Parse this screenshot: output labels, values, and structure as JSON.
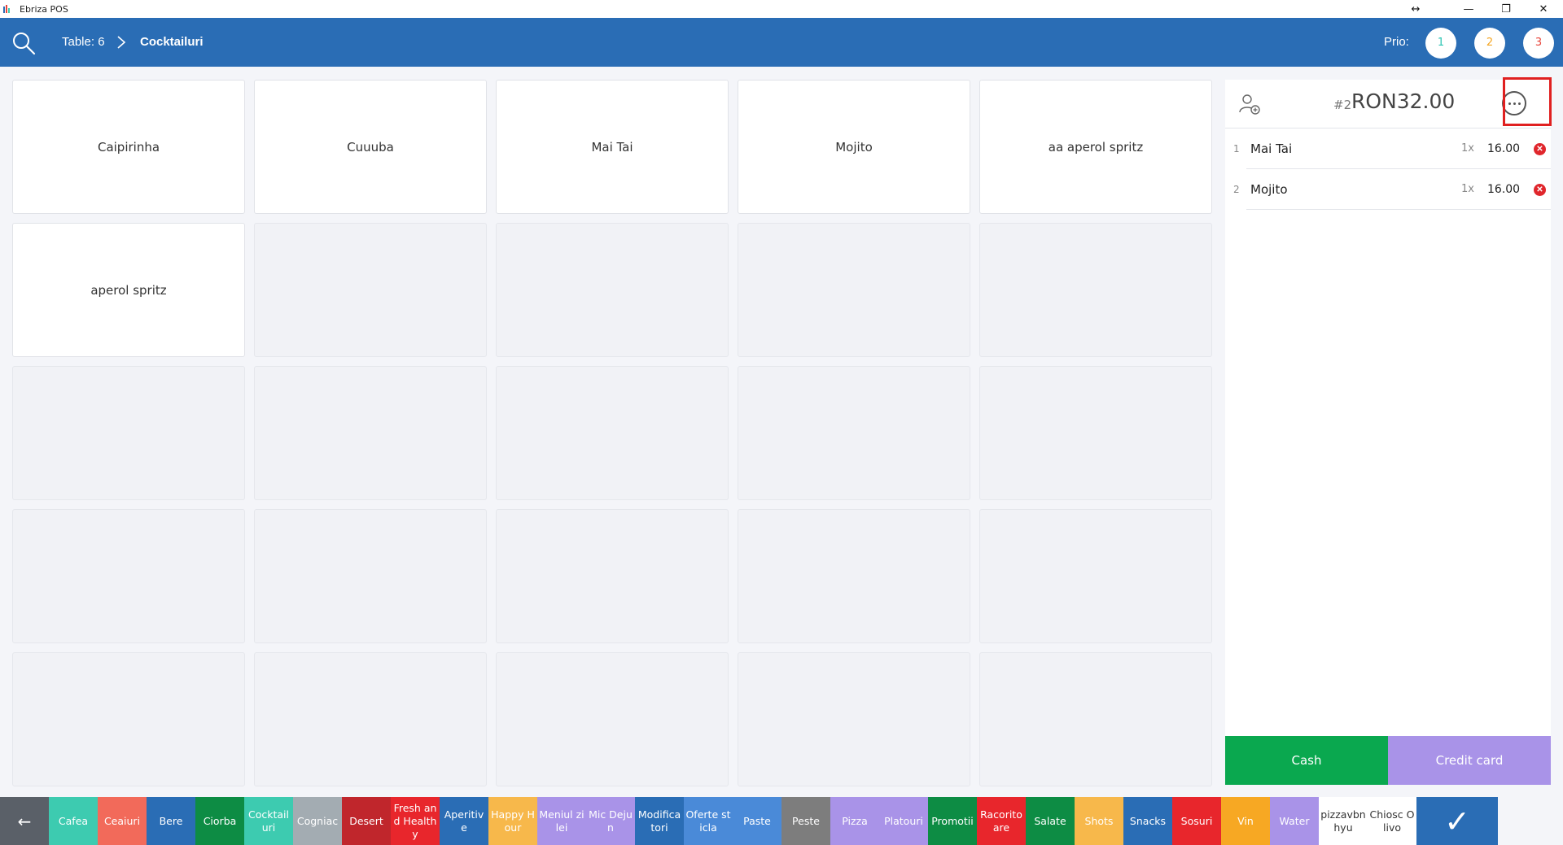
{
  "window": {
    "title": "Ebriza POS",
    "controls": {
      "resize": "↔",
      "minimize": "—",
      "restore": "❐",
      "close": "✕"
    }
  },
  "header": {
    "table": "Table: 6",
    "category": "Cocktailuri",
    "prio_label": "Prio:",
    "prio": [
      {
        "label": "1",
        "color": "#2bc4b3"
      },
      {
        "label": "2",
        "color": "#f5a623"
      },
      {
        "label": "3",
        "color": "#e8443a"
      }
    ]
  },
  "products": [
    "Caipirinha",
    "Cuuuba",
    "Mai Tai",
    "Mojito",
    "aa aperol spritz",
    "aperol spritz"
  ],
  "order": {
    "number": "#2",
    "total": "RON32.00",
    "items": [
      {
        "index": "1",
        "name": "Mai Tai",
        "qty": "1x",
        "price": "16.00"
      },
      {
        "index": "2",
        "name": "Mojito",
        "qty": "1x",
        "price": "16.00"
      }
    ],
    "cash_label": "Cash",
    "card_label": "Credit card",
    "cash_color": "#0aa84f",
    "card_color": "#a993e8"
  },
  "categories": [
    {
      "label": "Cafea",
      "color": "#3dcbb0"
    },
    {
      "label": "Ceaiuri",
      "color": "#f26a5a"
    },
    {
      "label": "Bere",
      "color": "#2a6db5"
    },
    {
      "label": "Ciorba",
      "color": "#0d8c44"
    },
    {
      "label": "Cocktailuri",
      "color": "#3dcbb0"
    },
    {
      "label": "Cogniac",
      "color": "#a3acb2"
    },
    {
      "label": "Desert",
      "color": "#c0262c"
    },
    {
      "label": "Fresh and Healthy",
      "color": "#e8262c"
    },
    {
      "label": "Aperitive",
      "color": "#2a6db5"
    },
    {
      "label": "Happy Hour",
      "color": "#f7b84b"
    },
    {
      "label": "Meniul zilei",
      "color": "#a993e8"
    },
    {
      "label": "Mic Dejun",
      "color": "#a993e8"
    },
    {
      "label": "Modificatori",
      "color": "#2a6db5"
    },
    {
      "label": "Oferte sticla",
      "color": "#4a8ad8"
    },
    {
      "label": "Paste",
      "color": "#4a8ad8"
    },
    {
      "label": "Peste",
      "color": "#7d7d7d"
    },
    {
      "label": "Pizza",
      "color": "#a993e8"
    },
    {
      "label": "Platouri",
      "color": "#a993e8"
    },
    {
      "label": "Promotii",
      "color": "#0d8c44"
    },
    {
      "label": "Racoritoare",
      "color": "#e8262c"
    },
    {
      "label": "Salate",
      "color": "#0d8c44"
    },
    {
      "label": "Shots",
      "color": "#f7b84b"
    },
    {
      "label": "Snacks",
      "color": "#2a6db5"
    },
    {
      "label": "Sosuri",
      "color": "#e8262c"
    },
    {
      "label": "Vin",
      "color": "#f7a823"
    },
    {
      "label": "Water",
      "color": "#a993e8"
    },
    {
      "label": "pizzavbnhyu",
      "color": "#ffffff"
    },
    {
      "label": "Chiosc Olivo",
      "color": "#ffffff"
    }
  ],
  "back_label": "←",
  "confirm_label": "✓"
}
